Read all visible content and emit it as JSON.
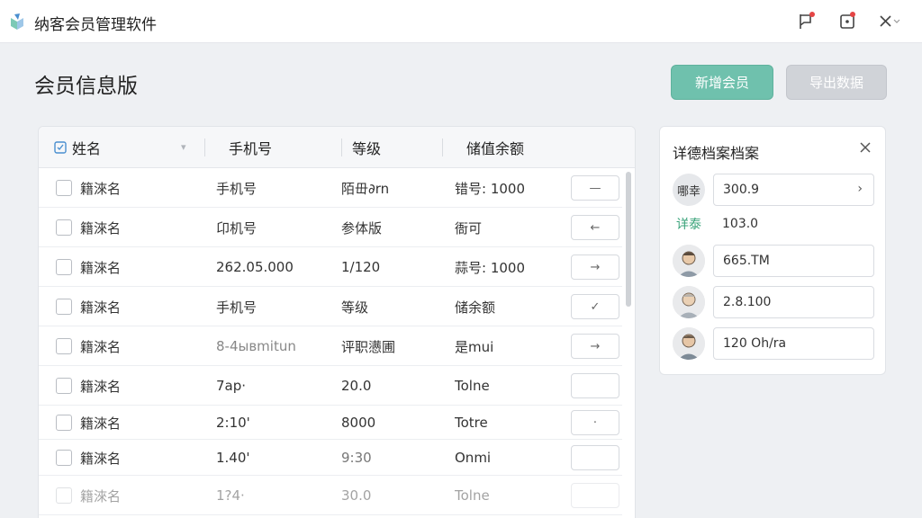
{
  "app": {
    "title": "纳客会员管理软件",
    "accent": "#6fc1ad"
  },
  "page": {
    "title": "会员信息版",
    "add_button": "新增会员",
    "export_button": "导出数据"
  },
  "table": {
    "columns": [
      "姓名",
      "手机号",
      "等级",
      "储值余额"
    ],
    "rows": [
      {
        "name": "籍淶名",
        "phone": "手机号",
        "level": "陌毌∂rn",
        "balance": "错号: 1000",
        "action": "—"
      },
      {
        "name": "籍淶名",
        "phone": "卬机号",
        "level": "参体版",
        "balance": "衙可",
        "action": "←"
      },
      {
        "name": "籍淶名",
        "phone": "262.05.000",
        "level": "1/120",
        "balance": "蒜号: 1000",
        "action": "→"
      },
      {
        "name": "籍淶名",
        "phone": "手机号",
        "level": "等级",
        "balance": "储余额",
        "action": "✓"
      },
      {
        "name": "籍淶名",
        "phone": "8-4ывmitun",
        "level": "评职懑圃",
        "balance": "是mui",
        "action": "→"
      },
      {
        "name": "籍淶名",
        "phone": "7ap·",
        "level": "20.0",
        "balance": "Tolne",
        "action": ""
      },
      {
        "name": "籍淶名",
        "phone": "2:10'",
        "level": "8000",
        "balance": "Totre",
        "action": "·"
      },
      {
        "name": "籍淶名",
        "phone": "1.40'",
        "level": "9:30",
        "balance": "Onmi",
        "action": ""
      },
      {
        "name": "籍淶名",
        "phone": "1?4·",
        "level": "30.0",
        "balance": "Tolne",
        "action": ""
      }
    ]
  },
  "side_panel": {
    "title": "详德档案档案",
    "rows": [
      {
        "avatar_text": "哪幸",
        "value": "300.9",
        "chevron": "›"
      },
      {
        "tag": "详泰",
        "value": "103.0"
      },
      {
        "value": "665.TM"
      },
      {
        "value": "2.8.100"
      },
      {
        "value": "120 Oh/ra"
      }
    ]
  }
}
